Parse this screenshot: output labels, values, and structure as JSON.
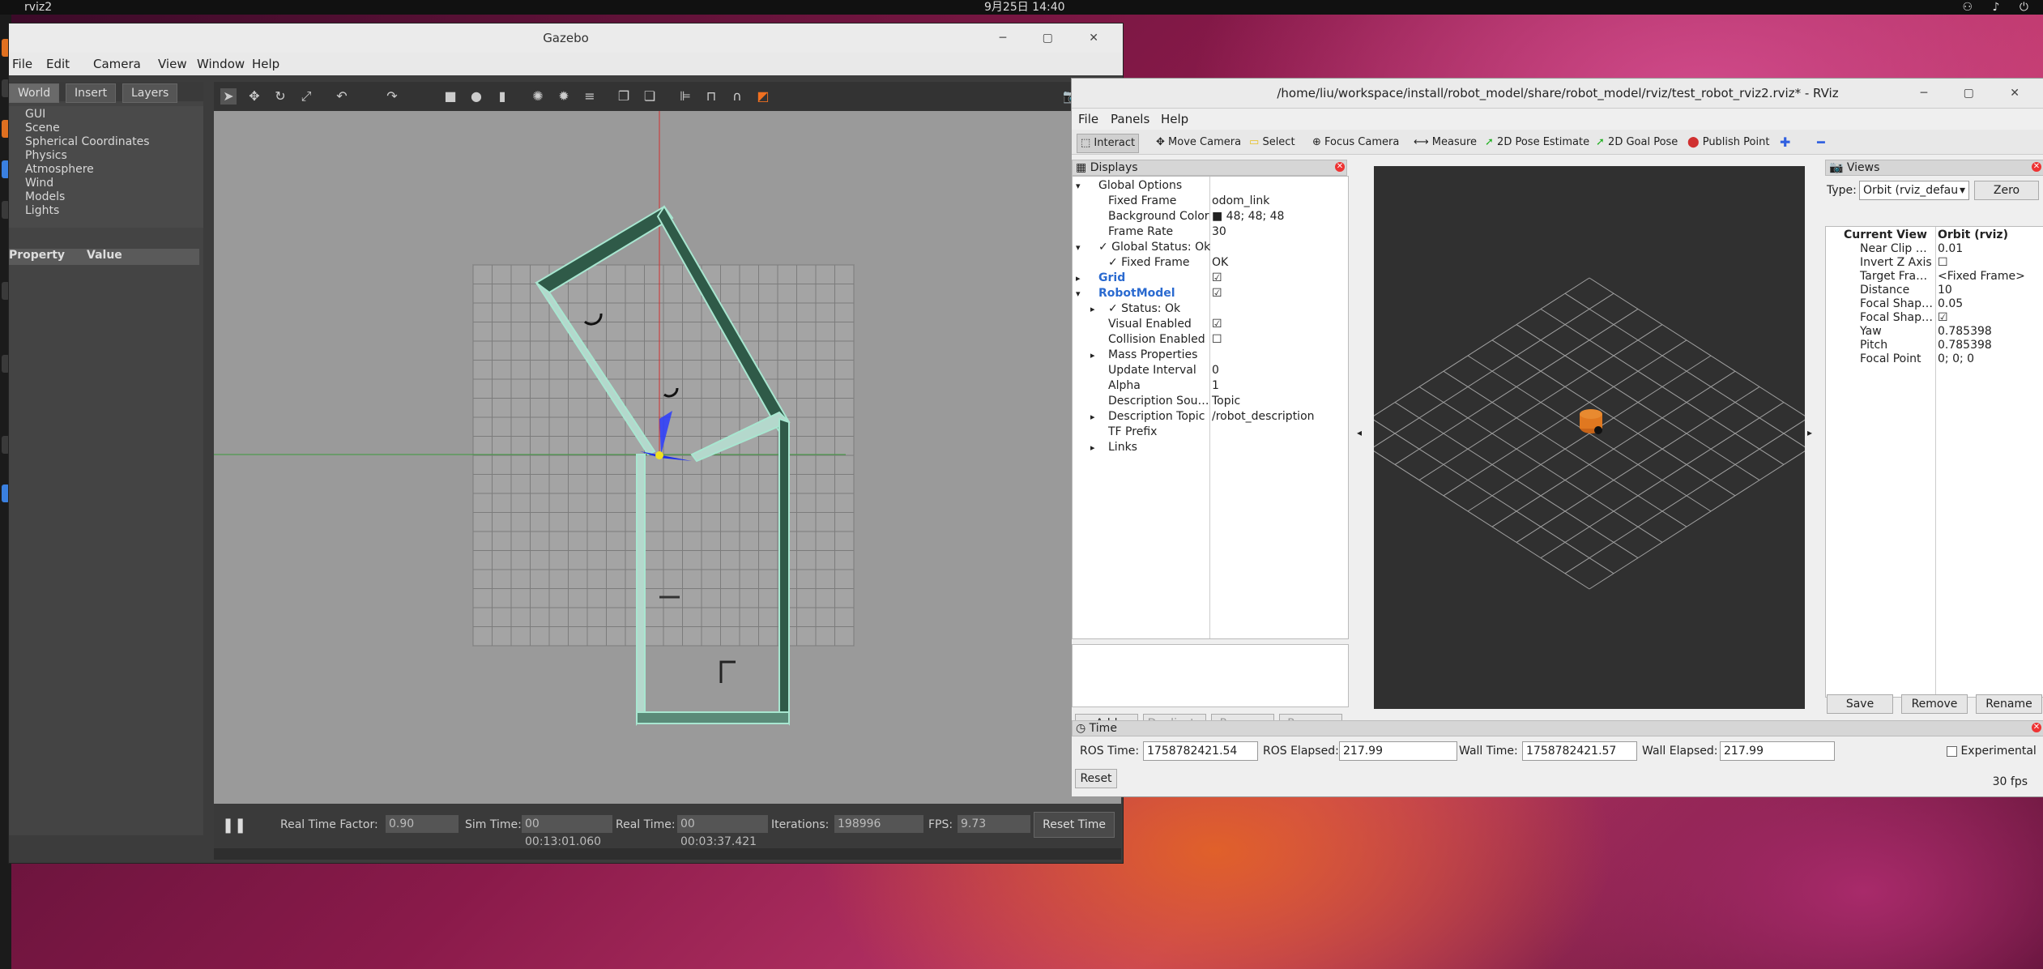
{
  "topbar": {
    "app": "rviz2",
    "clock": "9月25日 14:40",
    "tray": "⚇ ♪ ⏻"
  },
  "gazebo": {
    "title": "Gazebo",
    "menu": [
      "File",
      "Edit",
      "Camera",
      "View",
      "Window",
      "Help"
    ],
    "tabs": [
      "World",
      "Insert",
      "Layers"
    ],
    "tree": [
      "GUI",
      "Scene",
      "Spherical Coordinates",
      "Physics",
      "Atmosphere",
      "Wind",
      "Models",
      "Lights"
    ],
    "property_header": {
      "property": "Property",
      "value": "Value"
    },
    "status": {
      "real_time_factor_label": "Real Time Factor:",
      "real_time_factor": "0.90",
      "sim_time_label": "Sim Time:",
      "sim_time": "00 00:13:01.060",
      "real_time_label": "Real Time:",
      "real_time": "00 00:03:37.421",
      "iterations_label": "Iterations:",
      "iterations": "198996",
      "fps_label": "FPS:",
      "fps": "9.73",
      "reset_time": "Reset Time"
    }
  },
  "rviz": {
    "title": "/home/liu/workspace/install/robot_model/share/robot_model/rviz/test_robot_rviz2.rviz* - RViz",
    "menu": [
      "File",
      "Panels",
      "Help"
    ],
    "tools": [
      "Interact",
      "Move Camera",
      "Select",
      "Focus Camera",
      "Measure",
      "2D Pose Estimate",
      "2D Goal Pose",
      "Publish Point"
    ],
    "displays_title": "Displays",
    "displays": [
      {
        "k": "Global Options",
        "v": "",
        "indent": 0,
        "exp": "▾"
      },
      {
        "k": "Fixed Frame",
        "v": "odom_link",
        "indent": 1,
        "exp": ""
      },
      {
        "k": "Background Color",
        "v": "■ 48; 48; 48",
        "indent": 1,
        "exp": ""
      },
      {
        "k": "Frame Rate",
        "v": "30",
        "indent": 1,
        "exp": ""
      },
      {
        "k": "✓ Global Status: Ok",
        "v": "",
        "indent": 0,
        "exp": "▾"
      },
      {
        "k": "✓ Fixed Frame",
        "v": "OK",
        "indent": 1,
        "exp": ""
      },
      {
        "k": "Grid",
        "v": "☑",
        "indent": 0,
        "exp": "▸"
      },
      {
        "k": "RobotModel",
        "v": "☑",
        "indent": 0,
        "exp": "▾"
      },
      {
        "k": "✓ Status: Ok",
        "v": "",
        "indent": 1,
        "exp": "▸"
      },
      {
        "k": "Visual Enabled",
        "v": "☑",
        "indent": 1,
        "exp": ""
      },
      {
        "k": "Collision Enabled",
        "v": "☐",
        "indent": 1,
        "exp": ""
      },
      {
        "k": "Mass Properties",
        "v": "",
        "indent": 1,
        "exp": "▸"
      },
      {
        "k": "Update Interval",
        "v": "0",
        "indent": 1,
        "exp": ""
      },
      {
        "k": "Alpha",
        "v": "1",
        "indent": 1,
        "exp": ""
      },
      {
        "k": "Description Sou…",
        "v": "Topic",
        "indent": 1,
        "exp": ""
      },
      {
        "k": "Description Topic",
        "v": "/robot_description",
        "indent": 1,
        "exp": "▸"
      },
      {
        "k": "TF Prefix",
        "v": "",
        "indent": 1,
        "exp": ""
      },
      {
        "k": "Links",
        "v": "",
        "indent": 1,
        "exp": "▸"
      }
    ],
    "display_buttons": [
      "Add",
      "Duplicate",
      "Remove",
      "Rename"
    ],
    "views_title": "Views",
    "views_type_label": "Type:",
    "views_type": "Orbit (rviz_defau",
    "views_zero": "Zero",
    "views": [
      {
        "k": "Current View",
        "v": "Orbit (rviz)",
        "bold": true
      },
      {
        "k": "Near Clip …",
        "v": "0.01"
      },
      {
        "k": "Invert Z Axis",
        "v": "☐"
      },
      {
        "k": "Target Fra…",
        "v": "<Fixed Frame>"
      },
      {
        "k": "Distance",
        "v": "10"
      },
      {
        "k": "Focal Shap…",
        "v": "0.05"
      },
      {
        "k": "Focal Shap…",
        "v": "☑"
      },
      {
        "k": "Yaw",
        "v": "0.785398"
      },
      {
        "k": "Pitch",
        "v": "0.785398"
      },
      {
        "k": "Focal Point",
        "v": "0; 0; 0"
      }
    ],
    "view_buttons": [
      "Save",
      "Remove",
      "Rename"
    ],
    "time": {
      "title": "Time",
      "ros_time_label": "ROS Time:",
      "ros_time": "1758782421.54",
      "ros_elapsed_label": "ROS Elapsed:",
      "ros_elapsed": "217.99",
      "wall_time_label": "Wall Time:",
      "wall_time": "1758782421.57",
      "wall_elapsed_label": "Wall Elapsed:",
      "wall_elapsed": "217.99",
      "experimental": "Experimental",
      "reset": "Reset",
      "fps": "30 fps"
    }
  }
}
